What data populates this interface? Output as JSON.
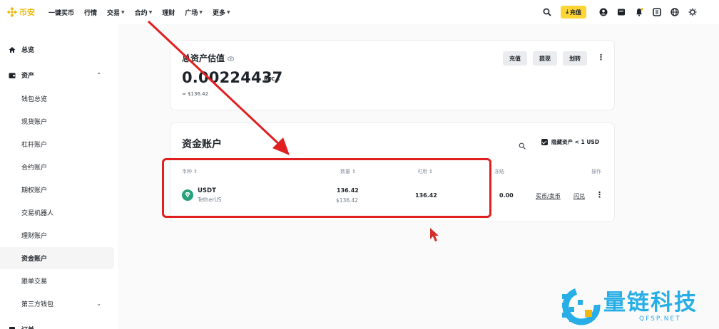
{
  "brand": {
    "name": "币安",
    "color": "#f0b90b"
  },
  "nav": {
    "items": [
      {
        "label": "一键买币",
        "dropdown": false
      },
      {
        "label": "行情",
        "dropdown": false
      },
      {
        "label": "交易",
        "dropdown": true
      },
      {
        "label": "合约",
        "dropdown": true
      },
      {
        "label": "理财",
        "dropdown": false
      },
      {
        "label": "广场",
        "dropdown": true
      },
      {
        "label": "更多",
        "dropdown": true
      }
    ],
    "deposit_label": "充值",
    "icons": [
      "search-icon",
      "user-icon",
      "orders-icon",
      "notification-icon",
      "download-icon",
      "globe-icon",
      "theme-icon"
    ]
  },
  "sidebar": {
    "overview": "总览",
    "assets": "资产",
    "items": [
      "钱包总览",
      "现货账户",
      "杠杆账户",
      "合约账户",
      "期权账户",
      "交易机器人",
      "理财账户",
      "资金账户",
      "跟单交易",
      "第三方钱包"
    ],
    "active": "资金账户",
    "cut_off": "订单"
  },
  "estimated": {
    "title": "总资产估值",
    "value": "0.00224437",
    "unit": "BTC",
    "usd": "≈ $136.42",
    "buttons": [
      "充值",
      "提现",
      "划转"
    ]
  },
  "funding": {
    "title": "资金账户",
    "hide_label": "隐藏资产 < 1 USD",
    "columns": [
      "币种",
      "数量",
      "可用",
      "冻结",
      "操作"
    ],
    "rows": [
      {
        "coin": "USDT",
        "coin_name": "TetherUS",
        "amount": "136.42",
        "amount_usd": "$136.42",
        "available": "136.42",
        "frozen": "0.00",
        "actions": [
          "买币/卖币",
          "闪兑"
        ]
      }
    ]
  },
  "watermark": {
    "name": "量链科技",
    "url": "QFSP.NET",
    "color": "#28aee6"
  },
  "colors": {
    "accent": "#fcd535",
    "annotation": "#e02020"
  }
}
